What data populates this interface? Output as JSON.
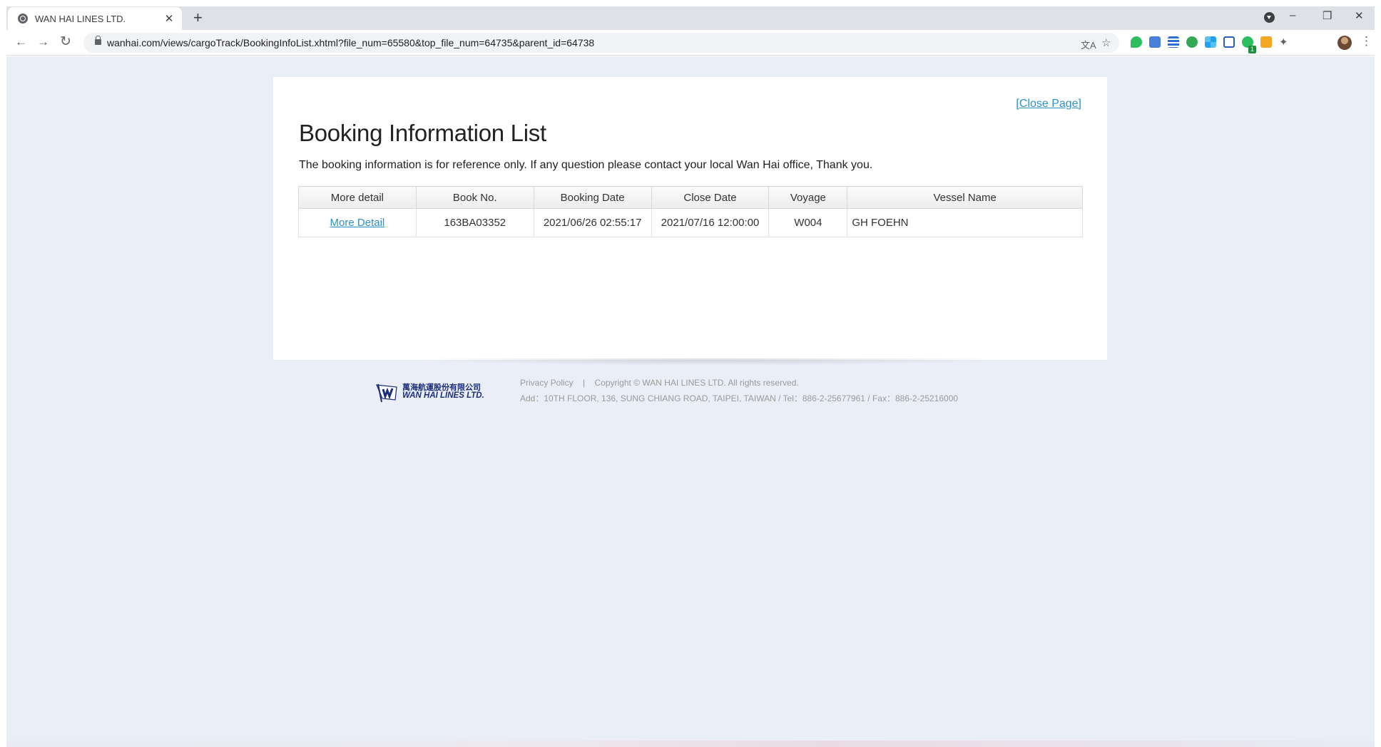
{
  "browser": {
    "tab_title": "WAN HAI LINES LTD.",
    "tab_close": "✕",
    "new_tab": "+",
    "url": "wanhai.com/views/cargoTrack/BookingInfoList.xhtml?file_num=65580&top_file_num=64735&parent_id=64738",
    "window_minimize": "–",
    "window_restore": "❐",
    "window_close": "✕",
    "extension_badge": "1",
    "icons": [
      "back-arrow-icon",
      "forward-arrow-icon",
      "reload-icon",
      "lock-icon",
      "translate-icon",
      "star-icon",
      "puzzle-icon",
      "menu-kebab-icon"
    ]
  },
  "page": {
    "close_link": "[Close Page]",
    "title": "Booking Information List",
    "note": "The booking information is for reference only. If any question please contact your local Wan Hai office, Thank you.",
    "table": {
      "headers": [
        "More detail",
        "Book No.",
        "Booking Date",
        "Close Date",
        "Voyage",
        "Vessel Name"
      ],
      "rows": [
        [
          "More Detail",
          "163BA03352",
          "2021/06/26 02:55:17",
          "2021/07/16 12:00:00",
          "W004",
          "GH FOEHN"
        ]
      ]
    }
  },
  "footer": {
    "logo_cn": "萬海航運股份有限公司",
    "logo_en": "WAN HAI LINES LTD.",
    "privacy": "Privacy Policy",
    "separator": "|",
    "copyright": "Copyright © WAN HAI LINES LTD. All rights reserved.",
    "address": "Add：10TH FLOOR, 136, SUNG CHIANG ROAD, TAIPEI, TAIWAN / Tel：886-2-25677961 / Fax：886-2-25216000"
  },
  "colors": {
    "link": "#2f8fc4",
    "page_background": "#eaeef7",
    "logo_navy": "#1b2d7a"
  }
}
